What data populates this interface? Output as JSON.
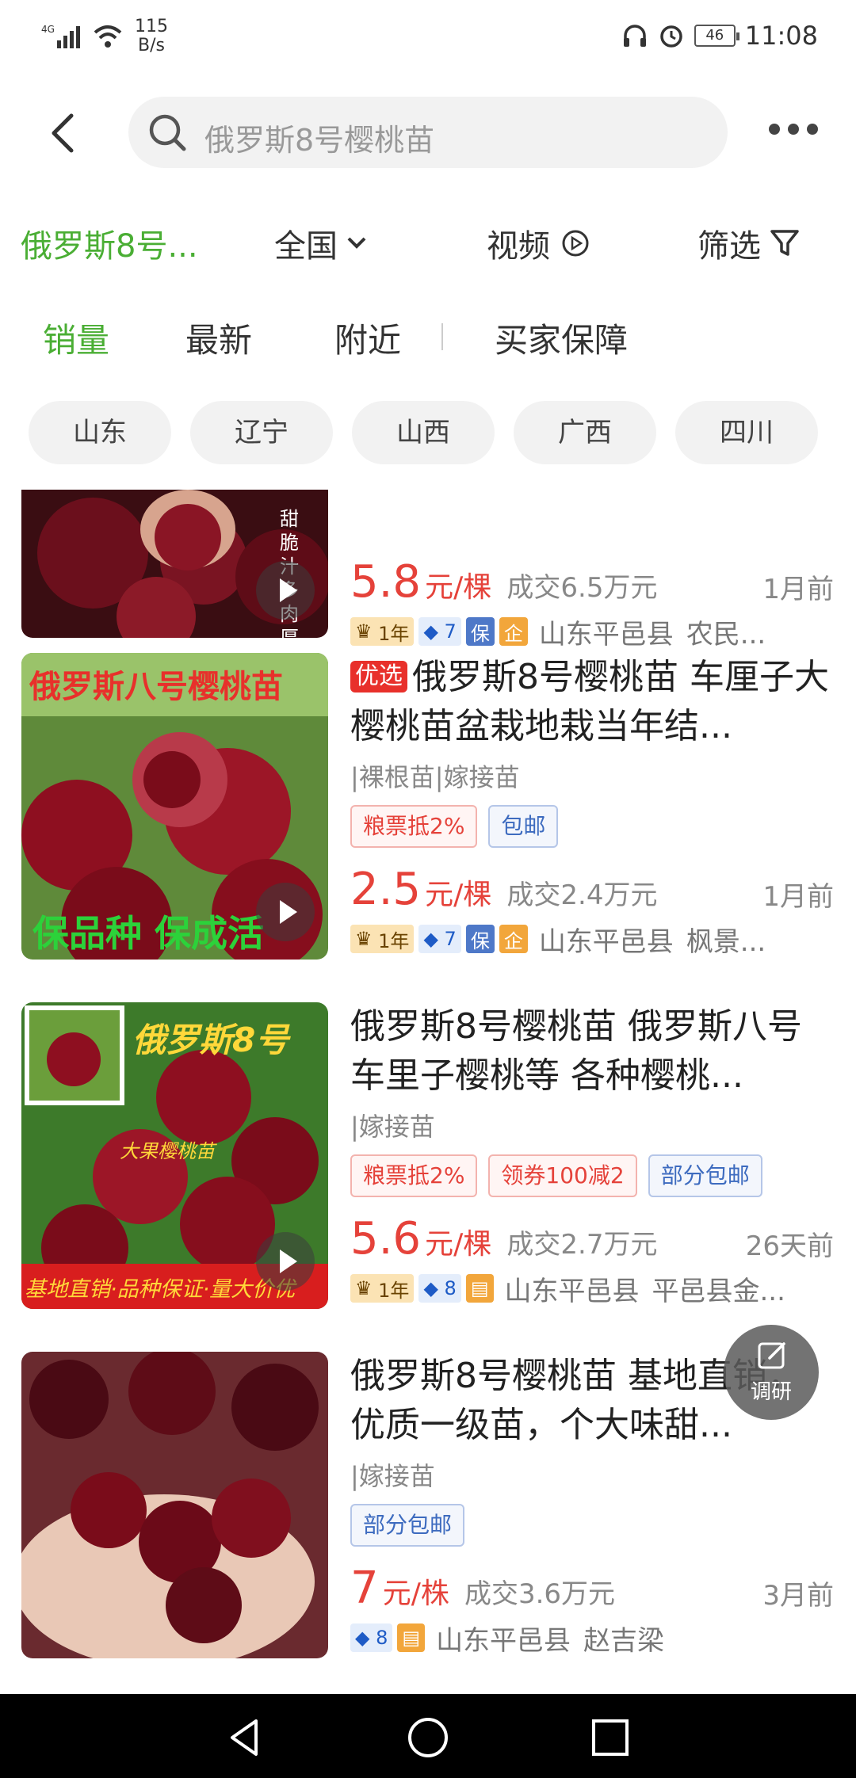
{
  "status": {
    "network": "4G",
    "speed": "115",
    "speed_unit": "B/s",
    "battery": "46",
    "time": "11:08"
  },
  "search": {
    "query": "俄罗斯8号樱桃苗"
  },
  "filters": {
    "keyword": "俄罗斯8号...",
    "region": "全国",
    "video": "视频",
    "filter": "筛选"
  },
  "tabs": [
    "销量",
    "最新",
    "附近",
    "买家保障"
  ],
  "chips": [
    "山东",
    "辽宁",
    "山西",
    "广西",
    "四川"
  ],
  "items": [
    {
      "thumb_text": "甜脆 汁多 肉厚",
      "price": "5.8",
      "unit": "元/棵",
      "deal": "成交6.5万元",
      "time": "1月前",
      "year": "1年",
      "diamond": "7",
      "bao": "保",
      "qi": "企",
      "location": "山东平邑县",
      "seller": "农民..."
    },
    {
      "badge": "优选",
      "title": "俄罗斯8号樱桃苗  车厘子大樱桃苗盆栽地栽当年结...",
      "thumb_text": "俄罗斯八号樱桃苗",
      "thumb_text2": "保品种  保成活",
      "spec": "|裸根苗|嫁接苗",
      "tags": [
        "粮票抵2%",
        "包邮"
      ],
      "price": "2.5",
      "unit": "元/棵",
      "deal": "成交2.4万元",
      "time": "1月前",
      "year": "1年",
      "diamond": "7",
      "bao": "保",
      "qi": "企",
      "location": "山东平邑县",
      "seller": "枫景..."
    },
    {
      "title": "俄罗斯8号樱桃苗  俄罗斯八号 车里子樱桃等 各种樱桃...",
      "thumb_text": "俄罗斯8号",
      "thumb_text2": "大果樱桃苗",
      "thumb_text3": "基地直销·品种保证·量大价优",
      "spec": "|嫁接苗",
      "tags": [
        "粮票抵2%",
        "领券100减2",
        "部分包邮"
      ],
      "price": "5.6",
      "unit": "元/棵",
      "deal": "成交2.7万元",
      "time": "26天前",
      "year": "1年",
      "diamond": "8",
      "location": "山东平邑县",
      "seller": "平邑县金..."
    },
    {
      "title": "俄罗斯8号樱桃苗 基地直销，优质一级苗，个大味甜...",
      "spec": "|嫁接苗",
      "tags": [
        "部分包邮"
      ],
      "price": "7",
      "unit": "元/株",
      "deal": "成交3.6万元",
      "time": "3月前",
      "diamond": "8",
      "location": "山东平邑县",
      "seller": "赵吉梁"
    }
  ],
  "survey": {
    "label": "调研"
  },
  "colors": {
    "accent": "#4aae34",
    "price": "#e5423a"
  }
}
